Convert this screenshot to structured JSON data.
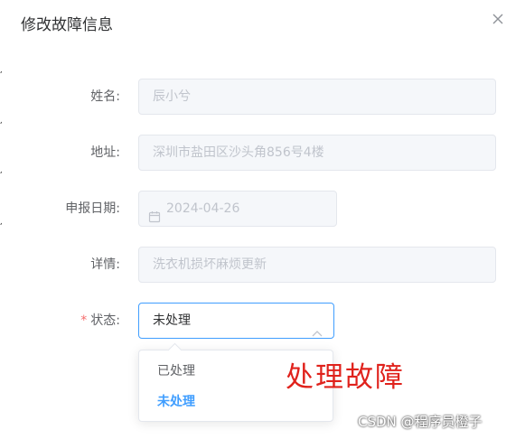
{
  "dialog": {
    "title": "修改故障信息",
    "fields": {
      "name": {
        "label": "姓名:",
        "value": "辰小兮"
      },
      "address": {
        "label": "地址:",
        "value": "深圳市盐田区沙头角856号4楼"
      },
      "date": {
        "label": "申报日期:",
        "value": "2024-04-26"
      },
      "details": {
        "label": "详情:",
        "value": "洗衣机损坏麻烦更新"
      },
      "status": {
        "required_mark": "*",
        "label": "状态:",
        "value": "未处理"
      }
    },
    "status_options": [
      {
        "label": "已处理",
        "selected": false
      },
      {
        "label": "未处理",
        "selected": true
      }
    ]
  },
  "annotation": "处理故障",
  "watermark": "CSDN @程序员橙子",
  "edge_fragments": [
    "亻",
    "亻",
    "亻",
    "亻",
    "亻",
    "亻",
    "亻",
    "亻"
  ],
  "colors": {
    "primary": "#409eff",
    "required": "#f56c6c",
    "annotation": "#e0221c"
  },
  "icons": {
    "close": "close-icon",
    "calendar": "calendar-icon",
    "status_arrow": "arrow-up-icon"
  }
}
